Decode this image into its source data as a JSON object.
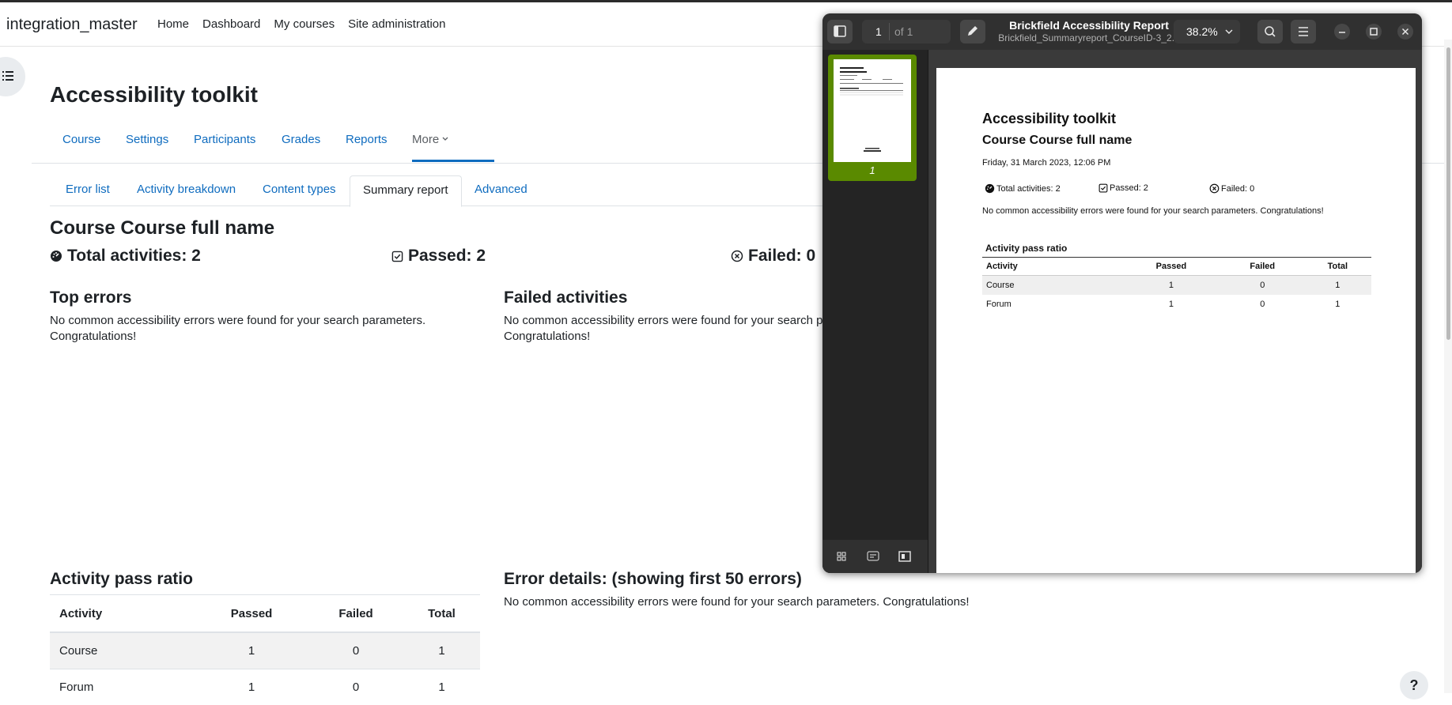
{
  "site": {
    "name": "integration_master"
  },
  "nav": {
    "items": [
      "Home",
      "Dashboard",
      "My courses",
      "Site administration"
    ]
  },
  "page": {
    "title": "Accessibility toolkit"
  },
  "secondary_nav": {
    "items": [
      "Course",
      "Settings",
      "Participants",
      "Grades",
      "Reports",
      "More"
    ],
    "active": "Reports"
  },
  "report_tabs": {
    "items": [
      "Error list",
      "Activity breakdown",
      "Content types",
      "Summary report",
      "Advanced"
    ],
    "active": "Summary report"
  },
  "summary": {
    "course_heading": "Course Course full name",
    "total": "Total activities: 2",
    "passed": "Passed: 2",
    "failed": "Failed: 0"
  },
  "top_errors": {
    "title": "Top errors",
    "message": "No common accessibility errors were found for your search parameters. Congratulations!"
  },
  "failed_activities": {
    "title": "Failed activities",
    "message": "No common accessibility errors were found for your search parameters. Congratulations!"
  },
  "pass_ratio": {
    "title": "Activity pass ratio",
    "headers": [
      "Activity",
      "Passed",
      "Failed",
      "Total"
    ],
    "rows": [
      {
        "activity": "Course",
        "passed": "1",
        "failed": "0",
        "total": "1"
      },
      {
        "activity": "Forum",
        "passed": "1",
        "failed": "0",
        "total": "1"
      }
    ]
  },
  "error_details": {
    "title": "Error details: (showing first 50 errors)",
    "message": "No common accessibility errors were found for your search parameters. Congratulations!"
  },
  "help": {
    "label": "?"
  },
  "pdf_viewer": {
    "title": "Brickfield Accessibility Report",
    "filename": "Brickfield_Summaryreport_CourseID-3_2...",
    "page_current": "1",
    "page_total": "of 1",
    "zoom": "38.2%",
    "thumb_page_number": "1",
    "document": {
      "title": "Accessibility toolkit",
      "course": "Course Course full name",
      "date": "Friday, 31 March 2023, 12:06 PM",
      "total": "Total activities: 2",
      "passed": "Passed: 2",
      "failed": "Failed: 0",
      "message": "No common accessibility errors were found for your search parameters. Congratulations!",
      "table_title": "Activity pass ratio"
    }
  },
  "colors": {
    "link": "#0f6cbf",
    "thumb_selected": "#5a8a00",
    "viewer_bg": "#2a2a2a"
  }
}
